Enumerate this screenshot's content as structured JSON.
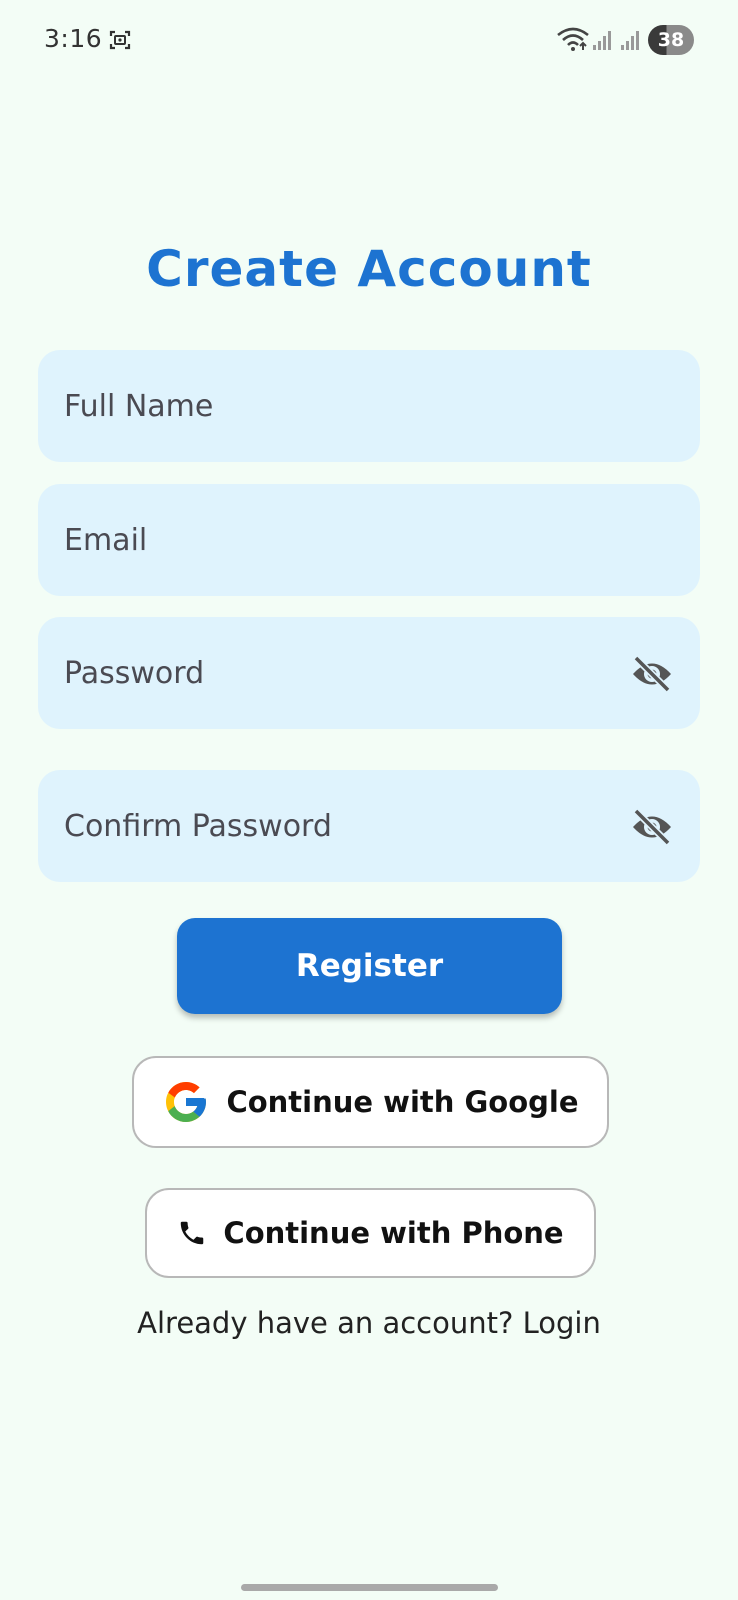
{
  "status_bar": {
    "time": "3:16",
    "battery": "38",
    "icons": [
      "screenshot-icon",
      "wifi-icon",
      "signal-icon",
      "signal-icon",
      "battery-icon"
    ]
  },
  "title": "Create Account",
  "fields": {
    "full_name": {
      "placeholder": "Full Name",
      "value": ""
    },
    "email": {
      "placeholder": "Email",
      "value": ""
    },
    "password": {
      "placeholder": "Password",
      "value": ""
    },
    "confirm_password": {
      "placeholder": "Confirm Password",
      "value": ""
    }
  },
  "buttons": {
    "register": "Register",
    "google": "Continue with Google",
    "phone": "Continue with Phone"
  },
  "login_line": {
    "prompt": "Already have an account? ",
    "link": "Login"
  },
  "colors": {
    "background": "#f3fdf6",
    "accent": "#1d73d1",
    "field_bg": "#dff3fd"
  }
}
